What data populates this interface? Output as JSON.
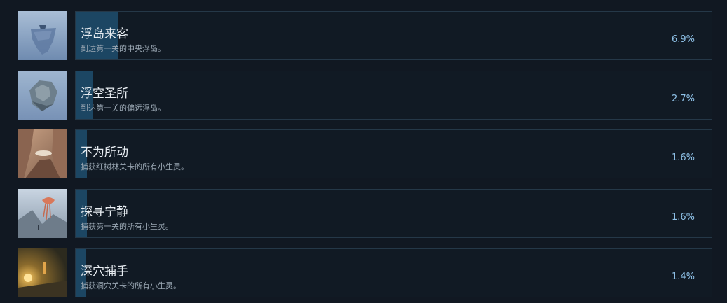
{
  "achievements": [
    {
      "title": "浮岛来客",
      "description": "到达第一关的中央浮岛。",
      "percent_label": "6.9%",
      "percent": 6.9,
      "icon": "floating-island-icon"
    },
    {
      "title": "浮空圣所",
      "description": "到达第一关的偏远浮岛。",
      "percent_label": "2.7%",
      "percent": 2.7,
      "icon": "floating-rock-icon"
    },
    {
      "title": "不为所动",
      "description": "捕获红树林关卡的所有小生灵。",
      "percent_label": "1.6%",
      "percent": 1.6,
      "icon": "mangrove-icon"
    },
    {
      "title": "探寻宁静",
      "description": "捕获第一关的所有小生灵。",
      "percent_label": "1.6%",
      "percent": 1.6,
      "icon": "jellyfish-tree-icon"
    },
    {
      "title": "深穴捕手",
      "description": "捕获洞穴关卡的所有小生灵。",
      "percent_label": "1.4%",
      "percent": 1.4,
      "icon": "cave-lantern-icon"
    }
  ],
  "colors": {
    "background": "#111822",
    "card_border": "#253848",
    "progress_fill": "#1c4663",
    "percent_text": "#8fc2e8"
  }
}
